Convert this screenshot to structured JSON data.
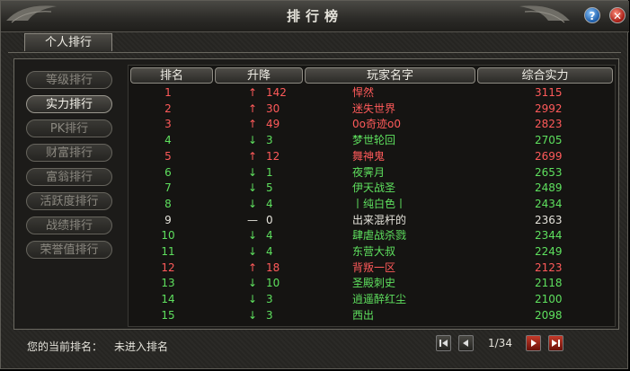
{
  "window": {
    "title": "排行榜",
    "help_label": "?",
    "close_label": "✕"
  },
  "tabs": [
    {
      "label": "个人排行"
    }
  ],
  "sidebar": {
    "items": [
      {
        "label": "等级排行"
      },
      {
        "label": "实力排行"
      },
      {
        "label": "PK排行"
      },
      {
        "label": "财富排行"
      },
      {
        "label": "富翁排行"
      },
      {
        "label": "活跃度排行"
      },
      {
        "label": "战绩排行"
      },
      {
        "label": "荣誉值排行"
      }
    ],
    "active_index": 1
  },
  "table": {
    "headers": [
      "排名",
      "升降",
      "玩家名字",
      "综合实力"
    ],
    "rows": [
      {
        "rank": "1",
        "trend": "up",
        "delta": "142",
        "name": "悍然",
        "power": "3115"
      },
      {
        "rank": "2",
        "trend": "up",
        "delta": "30",
        "name": "迷失世界",
        "power": "2992"
      },
      {
        "rank": "3",
        "trend": "up",
        "delta": "49",
        "name": "0o奇迹o0",
        "power": "2823"
      },
      {
        "rank": "4",
        "trend": "down",
        "delta": "3",
        "name": "梦世轮回",
        "power": "2705"
      },
      {
        "rank": "5",
        "trend": "up",
        "delta": "12",
        "name": "舞神鬼",
        "power": "2699"
      },
      {
        "rank": "6",
        "trend": "down",
        "delta": "1",
        "name": "夜霁月",
        "power": "2653"
      },
      {
        "rank": "7",
        "trend": "down",
        "delta": "5",
        "name": "伊天战圣",
        "power": "2489"
      },
      {
        "rank": "8",
        "trend": "down",
        "delta": "4",
        "name": "丨纯白色丨",
        "power": "2434"
      },
      {
        "rank": "9",
        "trend": "same",
        "delta": "0",
        "name": "出来混杆的",
        "power": "2363"
      },
      {
        "rank": "10",
        "trend": "down",
        "delta": "4",
        "name": "肆虐战杀戮",
        "power": "2344"
      },
      {
        "rank": "11",
        "trend": "down",
        "delta": "4",
        "name": "东营大叔",
        "power": "2249"
      },
      {
        "rank": "12",
        "trend": "up",
        "delta": "18",
        "name": "背叛一区",
        "power": "2123"
      },
      {
        "rank": "13",
        "trend": "down",
        "delta": "10",
        "name": "圣殿刺史",
        "power": "2118"
      },
      {
        "rank": "14",
        "trend": "down",
        "delta": "3",
        "name": "逍遥醉红尘",
        "power": "2100"
      },
      {
        "rank": "15",
        "trend": "down",
        "delta": "3",
        "name": "西出",
        "power": "2098"
      }
    ]
  },
  "footer": {
    "current_rank_label": "您的当前排名：",
    "current_rank_value": "未进入排名",
    "page_info": "1/34",
    "first_icon": "first-page-icon",
    "prev_icon": "prev-page-icon",
    "next_icon": "next-page-icon",
    "last_icon": "last-page-icon"
  },
  "colors": {
    "up": "#ff5a5a",
    "down": "#5ee05e",
    "same": "#e6e4dc",
    "title_text": "#e4e2da"
  },
  "arrows": {
    "up": "↑",
    "down": "↓",
    "same": "—"
  }
}
